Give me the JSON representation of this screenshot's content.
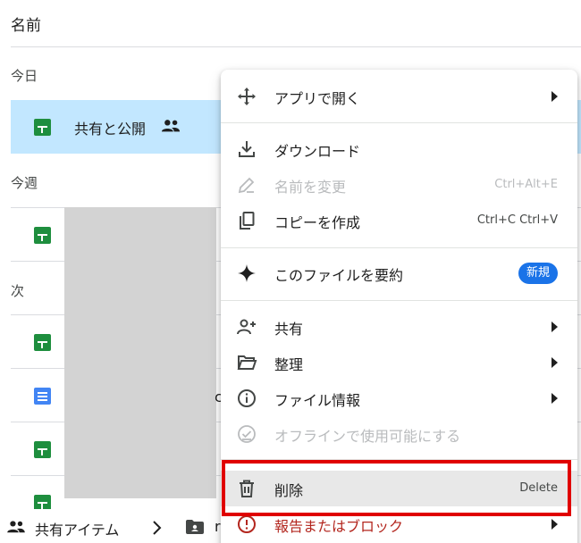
{
  "list": {
    "column_header": "名前",
    "sections": {
      "today": "今日",
      "this_week": "今週",
      "next": "次"
    },
    "selected_file_name": "共有と公開",
    "peek_char": "c"
  },
  "breadcrumb": {
    "shared_label": "共有アイテム",
    "folder_initial": "r"
  },
  "menu": {
    "open_with": "アプリで開く",
    "download": "ダウンロード",
    "rename": "名前を変更",
    "rename_shortcut": "Ctrl+Alt+E",
    "make_copy": "コピーを作成",
    "make_copy_shortcut": "Ctrl+C Ctrl+V",
    "summarize": "このファイルを要約",
    "summarize_badge": "新規",
    "share": "共有",
    "organize": "整理",
    "file_info": "ファイル情報",
    "offline": "オフラインで使用可能にする",
    "delete": "削除",
    "delete_shortcut": "Delete",
    "report_block": "報告またはブロック"
  },
  "colors": {
    "selected_row": "#c2e7ff",
    "sheet_icon": "#1e8e3e",
    "doc_icon": "#4285f4",
    "badge": "#1a73e8",
    "danger": "#b3261e",
    "annotation_box": "#e00000"
  }
}
